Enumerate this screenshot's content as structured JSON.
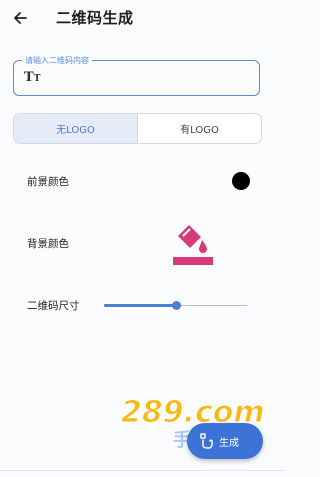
{
  "appbar": {
    "title": "二维码生成",
    "back_icon": "arrow-left-icon"
  },
  "content_field": {
    "label": "请输入二维码内容",
    "value": "",
    "icon": "text-format-icon",
    "icon_text": "T",
    "icon_sub": "T"
  },
  "logo_toggle": {
    "options": [
      {
        "label": "无LOGO",
        "selected": true
      },
      {
        "label": "有LOGO",
        "selected": false
      }
    ]
  },
  "foreground": {
    "label": "前景颜色",
    "color": "#000000"
  },
  "background": {
    "label": "背景颜色",
    "icon": "paint-bucket-icon",
    "color": "#d63a7a"
  },
  "size": {
    "label": "二维码尺寸",
    "value_fraction": 0.5
  },
  "fab": {
    "label": "生成",
    "icon": "qrcode-hand-icon"
  },
  "watermark": {
    "text_main": "289.com",
    "text_sub": "手游网"
  },
  "colors": {
    "accent": "#4f7fd2",
    "fab": "#3d73d6",
    "segment_active_bg": "#e5ecf8"
  }
}
